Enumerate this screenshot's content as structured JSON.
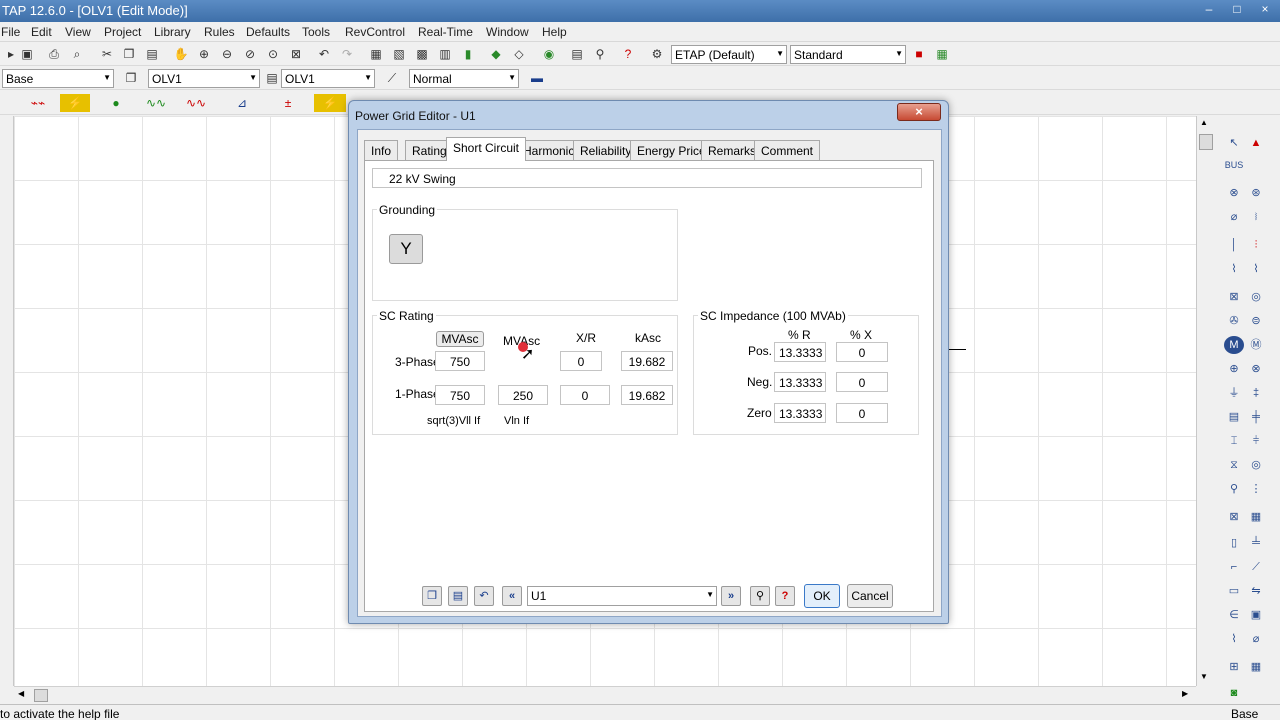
{
  "window": {
    "title": "TAP 12.6.0 - [OLV1 (Edit Mode)]",
    "controls": [
      "–",
      "□",
      "×"
    ]
  },
  "menu": [
    "File",
    "Edit",
    "View",
    "Project",
    "Library",
    "Rules",
    "Defaults",
    "Tools",
    "RevControl",
    "Real-Time",
    "Window",
    "Help"
  ],
  "toolbar": {
    "config_combo": "ETAP (Default)",
    "style_combo": "Standard",
    "base_combo": "Base",
    "olv_combo1": "OLV1",
    "olv_combo2": "OLV1",
    "mode_combo": "Normal"
  },
  "dialog": {
    "title": "Power Grid Editor - U1",
    "close": "×",
    "tabs": [
      "Info",
      "Rating",
      "Short Circuit",
      "Harmonic",
      "Reliability",
      "Energy Price",
      "Remarks",
      "Comment"
    ],
    "active_tab": "Short Circuit",
    "header_field": "22 kV  Swing",
    "grounding": {
      "label": "Grounding"
    },
    "sc_rating": {
      "label": "SC Rating",
      "col_mvasc_btn": "MVAsc",
      "col_mvasc": "MVAsc",
      "col_xr": "X/R",
      "col_kasc": "kAsc",
      "three_phase": {
        "label": "3-Phase",
        "mvasc": "750",
        "xr": "0",
        "kasc": "19.682"
      },
      "one_phase": {
        "label": "1-Phase",
        "mvasc1": "750",
        "mvasc2": "250",
        "xr": "0",
        "kasc": "19.682"
      },
      "foot1": "sqrt(3)Vll If",
      "foot2": "Vln If"
    },
    "sc_impedance": {
      "label": "SC Impedance (100 MVAb)",
      "col_r": "% R",
      "col_x": "% X",
      "pos": {
        "label": "Pos.",
        "r": "13.3333",
        "x": "0"
      },
      "neg": {
        "label": "Neg.",
        "r": "13.3333",
        "x": "0"
      },
      "zero": {
        "label": "Zero",
        "r": "13.3333",
        "x": "0"
      }
    },
    "nav": {
      "element": "U1",
      "ok": "OK",
      "cancel": "Cancel"
    }
  },
  "status": {
    "left": "to activate the help file",
    "right": "Base"
  }
}
